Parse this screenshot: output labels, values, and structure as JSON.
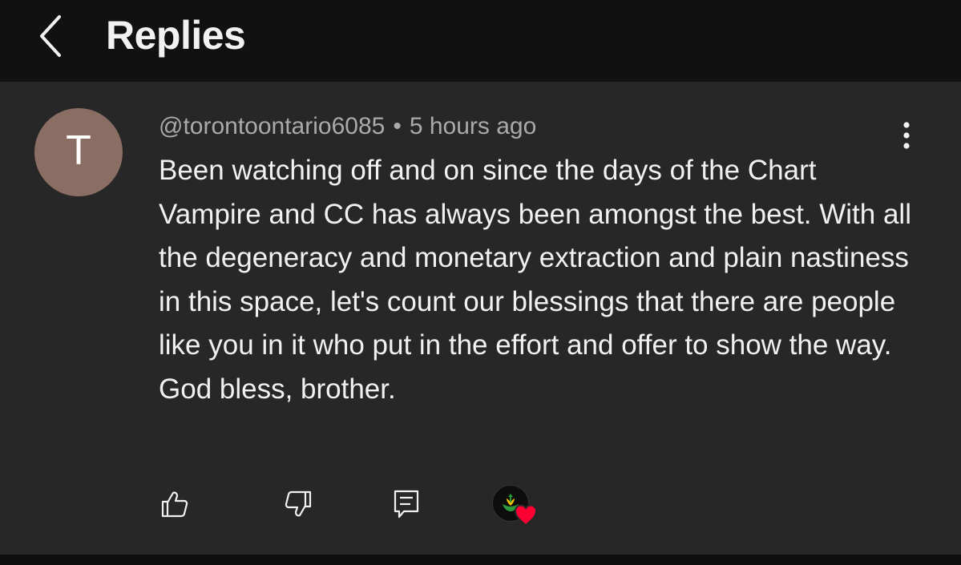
{
  "header": {
    "title": "Replies"
  },
  "comment": {
    "avatar_letter": "T",
    "avatar_color": "#8b6e63",
    "author": "@torontoontario6085",
    "separator": "•",
    "time_ago": "5 hours ago",
    "text": "Been watching off and on since the days of the Chart Vampire and CC has always been amongst the best. With all the degeneracy and monetary extraction and plain nastiness in this space, let's count our blessings that there are people like you in it who put in the effort and offer to show the way. God bless, brother."
  },
  "actions": {
    "like_icon": "thumb-up-icon",
    "dislike_icon": "thumb-down-icon",
    "reply_icon": "comment-reply-icon",
    "creator_heart_icon": "creator-heart-icon",
    "heart_color": "#ff0033"
  },
  "colors": {
    "header_bg": "#111111",
    "panel_bg": "#272727",
    "text_primary": "#f1f1f1",
    "text_secondary": "#aaaaaa"
  }
}
